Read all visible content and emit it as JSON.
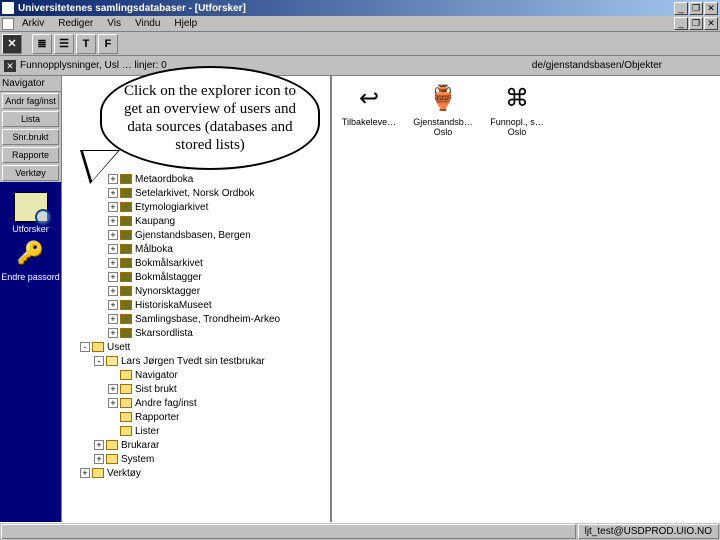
{
  "window": {
    "title": "Universitetenes samlingsdatabaser - [Utforsker]",
    "buttons": {
      "min": "_",
      "max": "❐",
      "close": "✕"
    },
    "child_buttons": {
      "min": "_",
      "max": "❐",
      "close": "✕"
    }
  },
  "menu": {
    "items": [
      "Arkiv",
      "Rediger",
      "Vis",
      "Vindu",
      "Hjelp"
    ]
  },
  "subbar": {
    "left_text": "Funnopplysninger, Usl …  linjer: 0",
    "right_text": "de/gjenstandsbasen/Objekter"
  },
  "nav": {
    "header": "Navigator",
    "buttons": [
      "Andr fag/inst",
      "Lista",
      "Snr.brukt",
      "Rapporte",
      "Verktøy"
    ],
    "big_items": [
      {
        "label": "Utforsker"
      },
      {
        "label": "Endre passord"
      }
    ]
  },
  "tree": {
    "items": [
      {
        "indent": 2,
        "exp": "+",
        "folder": "dk",
        "label": "Metaordboka"
      },
      {
        "indent": 2,
        "exp": "+",
        "folder": "dk",
        "label": "Setelarkivet, Norsk Ordbok"
      },
      {
        "indent": 2,
        "exp": "+",
        "folder": "dk",
        "label": "Etymologiarkivet"
      },
      {
        "indent": 2,
        "exp": "+",
        "folder": "dk",
        "label": "Kaupang"
      },
      {
        "indent": 2,
        "exp": "+",
        "folder": "dk",
        "label": "Gjenstandsbasen, Bergen"
      },
      {
        "indent": 2,
        "exp": "+",
        "folder": "dk",
        "label": "Målboka"
      },
      {
        "indent": 2,
        "exp": "+",
        "folder": "dk",
        "label": "Bokmålsarkivet"
      },
      {
        "indent": 2,
        "exp": "+",
        "folder": "dk",
        "label": "Bokmålstagger"
      },
      {
        "indent": 2,
        "exp": "+",
        "folder": "dk",
        "label": "Nynorsktagger"
      },
      {
        "indent": 2,
        "exp": "+",
        "folder": "dk",
        "label": "HistoriskaMuseet"
      },
      {
        "indent": 2,
        "exp": "+",
        "folder": "dk",
        "label": "Samlingsbase, Trondheim-Arkeo"
      },
      {
        "indent": 2,
        "exp": "+",
        "folder": "dk",
        "label": "Skarsordlista"
      },
      {
        "indent": 0,
        "exp": "-",
        "folder": "fl",
        "label": "Usett"
      },
      {
        "indent": 1,
        "exp": "-",
        "folder": "op",
        "label": "Lars Jørgen Tvedt sin testbrukar"
      },
      {
        "indent": 2,
        "exp": "",
        "folder": "fl",
        "label": "Navigator"
      },
      {
        "indent": 2,
        "exp": "+",
        "folder": "fl",
        "label": "Sist brukt"
      },
      {
        "indent": 2,
        "exp": "+",
        "folder": "fl",
        "label": "Andre fag/inst"
      },
      {
        "indent": 2,
        "exp": "",
        "folder": "fl",
        "label": "Rapporter"
      },
      {
        "indent": 2,
        "exp": "",
        "folder": "fl",
        "label": "Lister"
      },
      {
        "indent": 1,
        "exp": "+",
        "folder": "fl",
        "label": "Brukarar"
      },
      {
        "indent": 1,
        "exp": "+",
        "folder": "fl",
        "label": "System"
      },
      {
        "indent": 0,
        "exp": "+",
        "folder": "fl",
        "label": "Verktøy"
      }
    ]
  },
  "desktop_icons": [
    {
      "name": "back-icon",
      "glyph": "↩",
      "caption": "Tilbakeleve…"
    },
    {
      "name": "object-icon",
      "glyph": "🏺",
      "caption": "Gjenstandsb… Oslo"
    },
    {
      "name": "find-icon",
      "glyph": "⌘",
      "caption": "Funnopl., s… Oslo"
    }
  ],
  "callout": "Click on the explorer icon to get an overview of users and data sources (databases and stored lists)",
  "status": {
    "user": "ljt_test@USDPROD.UIO.NO"
  }
}
